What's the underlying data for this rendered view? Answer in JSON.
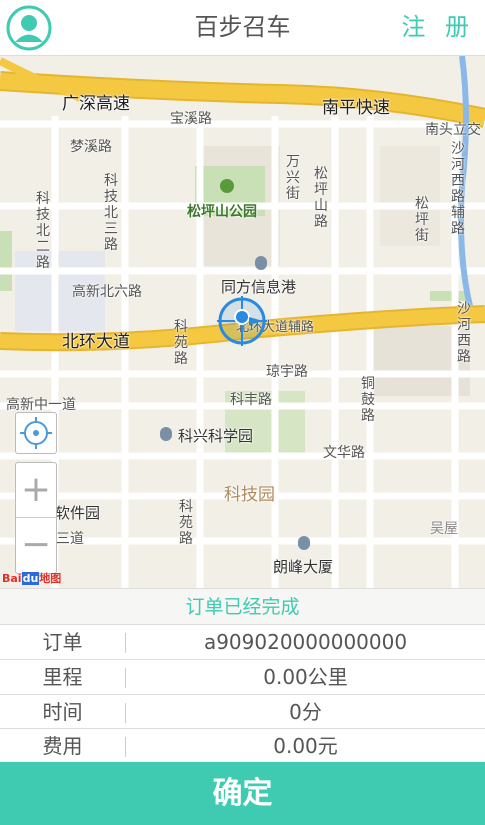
{
  "header": {
    "title": "百步召车",
    "register_label": "注 册"
  },
  "map": {
    "labels": {
      "guangshen": "广深高速",
      "nanping": "南平快速",
      "nantou": "南头立交",
      "baoxi": "宝溪路",
      "mengxi": "梦溪路",
      "keji_bei3": "科技北三路",
      "keji_bei2": "科技北二路",
      "wanxing": "万兴街",
      "songping_road": "松坪山路",
      "songping_street": "松坪街",
      "songping_park": "松坪山公园",
      "shahe_west_aux": "沙河西路辅路",
      "gaoxin_bei6": "高新北六路",
      "tongfang": "同方信息港",
      "beihuan": "北环大道",
      "beihuan_aux": "北环大道辅路",
      "keyuan1": "科苑路",
      "shahe_west": "沙河西路",
      "qiongyu": "琼宇路",
      "tonggu": "铜鼓路",
      "gaoxin_zhong1": "高新中一道",
      "kefeng": "科丰路",
      "kexing": "科兴科学园",
      "wenhua": "文华路",
      "kejiyuan": "科技园",
      "ruanjian": "软件园",
      "sandao": "三道",
      "keyuan2": "科苑路",
      "langfeng": "朗峰大厦",
      "wuwu": "吴屋"
    },
    "logo": "Bai du 地图"
  },
  "order": {
    "status": "订单已经完成",
    "rows": [
      {
        "key": "订单",
        "value": "a909020000000000"
      },
      {
        "key": "里程",
        "value": "0.00公里"
      },
      {
        "key": "时间",
        "value": "0分"
      },
      {
        "key": "费用",
        "value": "0.00元"
      }
    ]
  },
  "confirm_label": "确定",
  "colors": {
    "accent": "#3ecbb2",
    "highway": "#f5c842",
    "marker": "#2a8ae0"
  },
  "icons": [
    "user-icon",
    "locate-icon",
    "zoom-in-icon",
    "zoom-out-icon",
    "park-icon",
    "building-icon",
    "position-marker-icon"
  ]
}
